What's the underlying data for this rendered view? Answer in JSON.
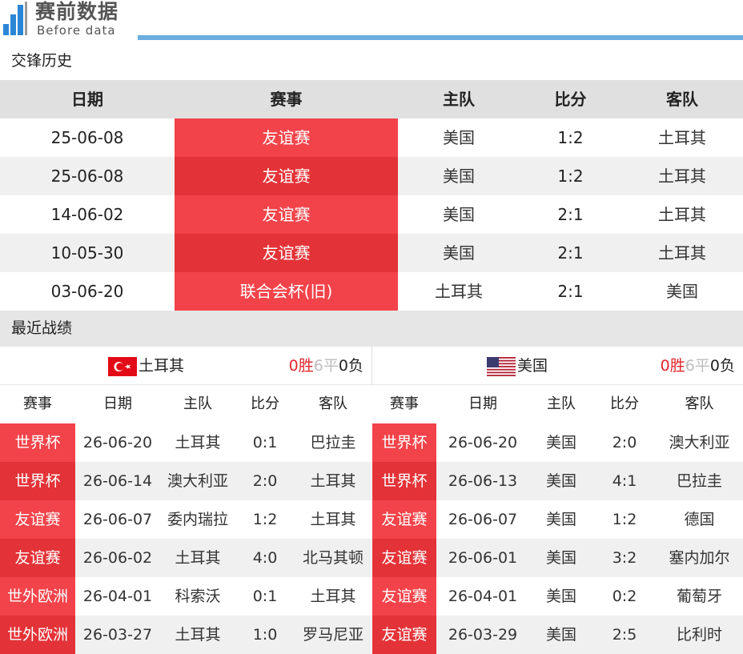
{
  "header": {
    "logo_title": "赛前数据",
    "logo_subtitle": "Before data",
    "brand_color": "#2b86d6"
  },
  "h2h": {
    "section_title": "交锋历史",
    "columns": {
      "date": "日期",
      "competition": "赛事",
      "home": "主队",
      "score": "比分",
      "away": "客队"
    },
    "rows": [
      {
        "date": "25-06-08",
        "competition": "友谊赛",
        "home": "美国",
        "score": "1:2",
        "away": "土耳其"
      },
      {
        "date": "25-06-08",
        "competition": "友谊赛",
        "home": "美国",
        "score": "1:2",
        "away": "土耳其"
      },
      {
        "date": "14-06-02",
        "competition": "友谊赛",
        "home": "美国",
        "score": "2:1",
        "away": "土耳其"
      },
      {
        "date": "10-05-30",
        "competition": "友谊赛",
        "home": "美国",
        "score": "2:1",
        "away": "土耳其"
      },
      {
        "date": "03-06-20",
        "competition": "联合会杯(旧)",
        "home": "土耳其",
        "score": "2:1",
        "away": "美国"
      }
    ]
  },
  "recent": {
    "section_title": "最近战绩",
    "columns": {
      "competition": "赛事",
      "date": "日期",
      "home": "主队",
      "score": "比分",
      "away": "客队"
    },
    "left": {
      "team": "土耳其",
      "flag_icon": "turkey-flag-icon",
      "record": {
        "win": "0",
        "win_label": "胜",
        "draw": "6",
        "draw_label": "平",
        "loss": "0",
        "loss_label": "负"
      },
      "rows": [
        {
          "competition": "世界杯",
          "date": "26-06-20",
          "home": "土耳其",
          "score": "0:1",
          "away": "巴拉圭"
        },
        {
          "competition": "世界杯",
          "date": "26-06-14",
          "home": "澳大利亚",
          "score": "2:0",
          "away": "土耳其"
        },
        {
          "competition": "友谊赛",
          "date": "26-06-07",
          "home": "委内瑞拉",
          "score": "1:2",
          "away": "土耳其"
        },
        {
          "competition": "友谊赛",
          "date": "26-06-02",
          "home": "土耳其",
          "score": "4:0",
          "away": "北马其顿"
        },
        {
          "competition": "世外欧洲",
          "date": "26-04-01",
          "home": "科索沃",
          "score": "0:1",
          "away": "土耳其"
        },
        {
          "competition": "世外欧洲",
          "date": "26-03-27",
          "home": "土耳其",
          "score": "1:0",
          "away": "罗马尼亚"
        }
      ]
    },
    "right": {
      "team": "美国",
      "flag_icon": "usa-flag-icon",
      "record": {
        "win": "0",
        "win_label": "胜",
        "draw": "6",
        "draw_label": "平",
        "loss": "0",
        "loss_label": "负"
      },
      "rows": [
        {
          "competition": "世界杯",
          "date": "26-06-20",
          "home": "美国",
          "score": "2:0",
          "away": "澳大利亚"
        },
        {
          "competition": "世界杯",
          "date": "26-06-13",
          "home": "美国",
          "score": "4:1",
          "away": "巴拉圭"
        },
        {
          "competition": "友谊赛",
          "date": "26-06-07",
          "home": "美国",
          "score": "1:2",
          "away": "德国"
        },
        {
          "competition": "友谊赛",
          "date": "26-06-01",
          "home": "美国",
          "score": "3:2",
          "away": "塞内加尔"
        },
        {
          "competition": "友谊赛",
          "date": "26-04-01",
          "home": "美国",
          "score": "0:2",
          "away": "葡萄牙"
        },
        {
          "competition": "友谊赛",
          "date": "26-03-29",
          "home": "美国",
          "score": "2:5",
          "away": "比利时"
        }
      ]
    }
  },
  "colors": {
    "competition_cell": "#f2434a",
    "competition_cell_dark": "#e33338",
    "win": "#e3262d",
    "draw": "#bdbdbd",
    "header_line": "#6aaee0"
  }
}
